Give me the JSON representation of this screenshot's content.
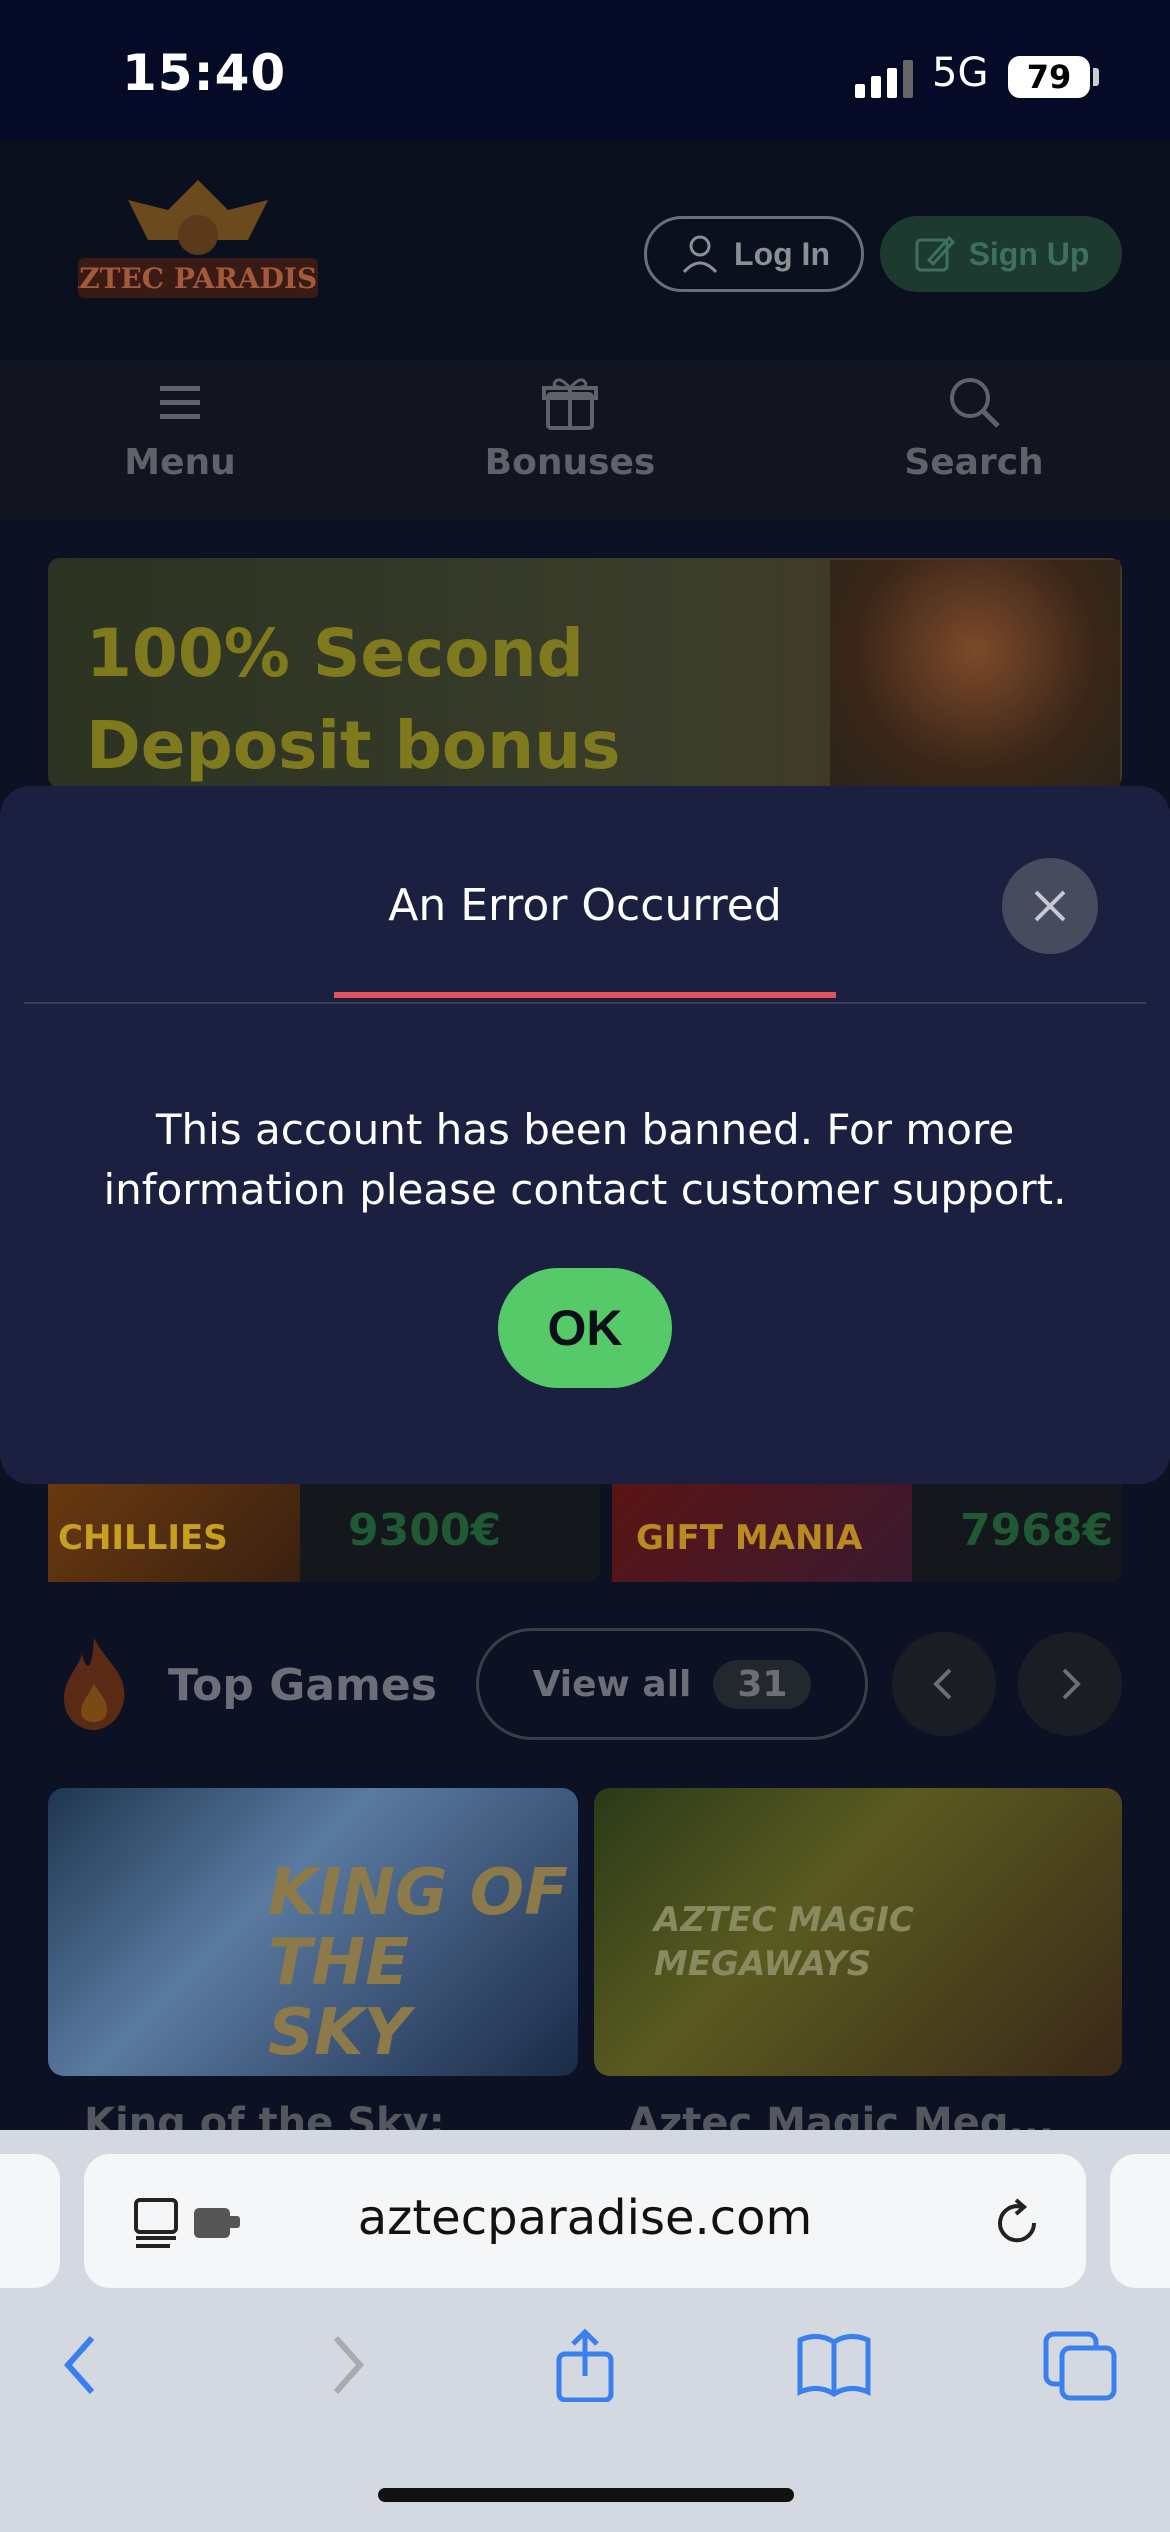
{
  "status_bar": {
    "time": "15:40",
    "network": "5G",
    "battery": "79"
  },
  "header": {
    "logo_text": "AZTEC PARADISE",
    "login_label": "Log In",
    "signup_label": "Sign Up"
  },
  "nav": {
    "menu_label": "Menu",
    "bonuses_label": "Bonuses",
    "search_label": "Search"
  },
  "banner": {
    "line1": "100% Second",
    "line2": "Deposit bonus"
  },
  "jackpots": [
    {
      "image_label": "CHILLIES",
      "value": "9300€"
    },
    {
      "image_label": "GIFT MANIA",
      "value": "7968€"
    }
  ],
  "top_games": {
    "title": "Top Games",
    "view_all_label": "View all",
    "count": "31",
    "games": [
      {
        "art_text": "KING OF THE SKY",
        "title": "King of the Sky:"
      },
      {
        "art_text": "AZTEC MAGIC MEGAWAYS",
        "title": "Aztec Magic Meg..."
      }
    ]
  },
  "modal": {
    "title": "An Error Occurred",
    "message": "This account has been banned. For more information please contact customer support.",
    "ok_label": "OK"
  },
  "browser": {
    "url": "aztecparadise.com"
  },
  "colors": {
    "modal_bg": "#1b2040",
    "accent_underline": "#e0545a",
    "ok_button": "#56c968"
  }
}
